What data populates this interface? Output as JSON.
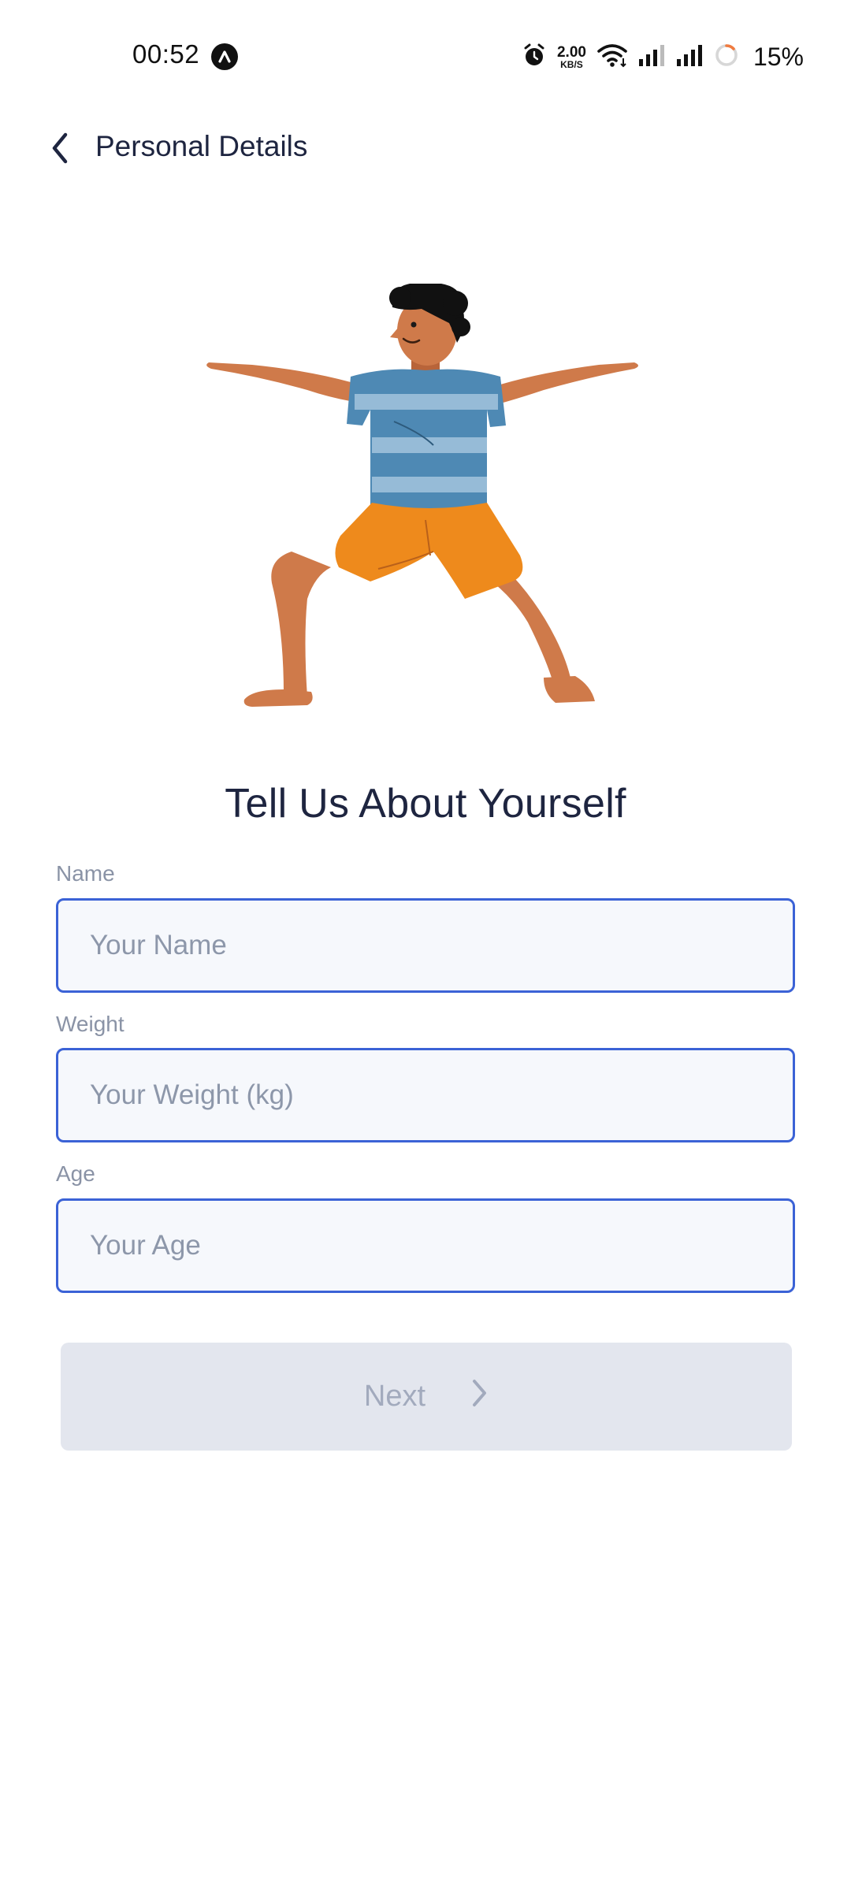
{
  "status_bar": {
    "time": "00:52",
    "net_speed_value": "2.00",
    "net_speed_unit": "KB/S",
    "battery": "15%",
    "icons": [
      "app-notification-icon",
      "alarm-icon",
      "wifi-icon",
      "signal-icon",
      "signal-icon",
      "battery-icon"
    ]
  },
  "header": {
    "title": "Personal Details",
    "back_icon": "chevron-left-icon"
  },
  "main": {
    "heading": "Tell Us About Yourself"
  },
  "form": {
    "name": {
      "label": "Name",
      "placeholder": "Your Name",
      "value": ""
    },
    "weight": {
      "label": "Weight",
      "placeholder": "Your Weight (kg)",
      "value": ""
    },
    "age": {
      "label": "Age",
      "placeholder": "Your Age",
      "value": ""
    },
    "next_label": "Next",
    "next_icon": "chevron-right-icon"
  },
  "colors": {
    "accent": "#3b62d6",
    "title_text": "#1e2540",
    "label_text": "#8a93a6",
    "input_bg": "#f6f8fc",
    "button_disabled_bg": "#e3e6ee",
    "button_disabled_text": "#a2aabd",
    "shirt_blue": "#4e89b4",
    "shorts_orange": "#ee8a1c",
    "skin": "#cf7a4a"
  }
}
